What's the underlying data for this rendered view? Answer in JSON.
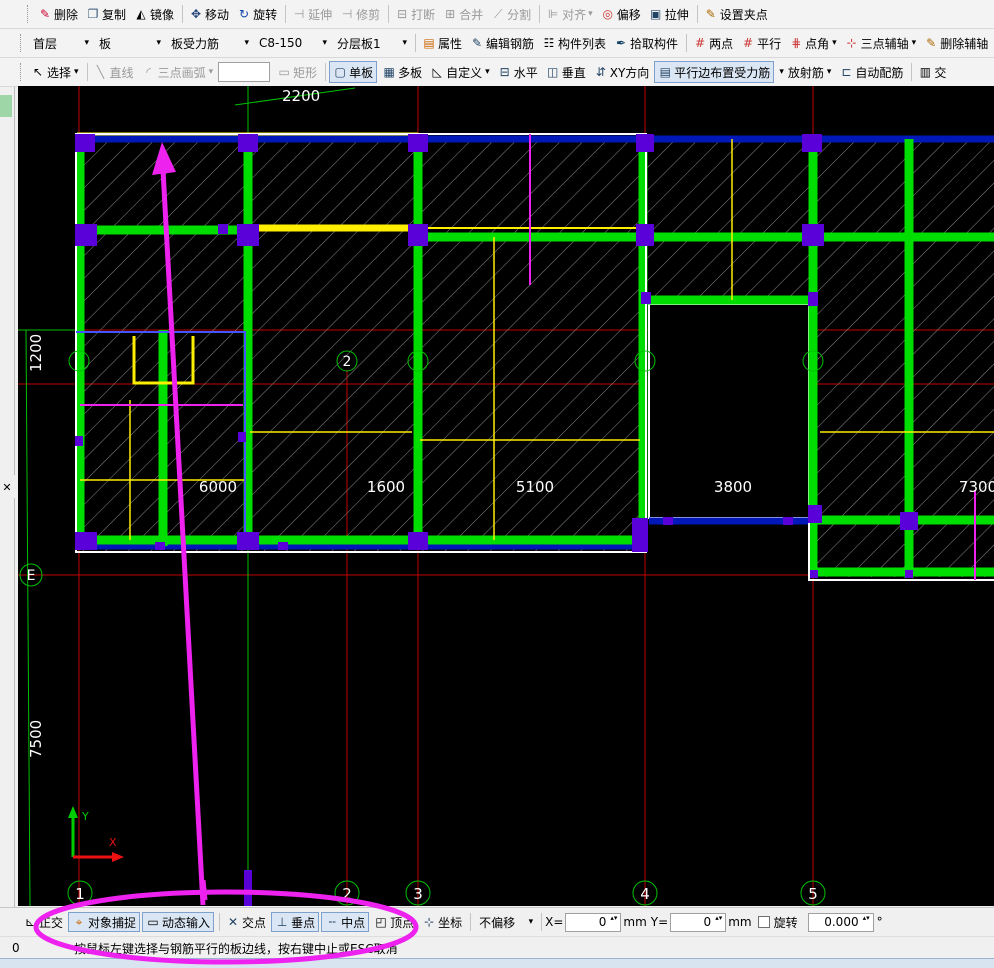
{
  "toolbar1": {
    "delete": "删除",
    "copy": "复制",
    "mirror": "镜像",
    "move": "移动",
    "rotate": "旋转",
    "extend": "延伸",
    "trim": "修剪",
    "break": "打断",
    "merge": "合并",
    "split": "分割",
    "align": "对齐",
    "offset": "偏移",
    "stretch": "拉伸",
    "set_grip": "设置夹点"
  },
  "toolbar2": {
    "floor": "首层",
    "component_type": "板",
    "rebar_type": "板受力筋",
    "rebar_spec": "C8-150",
    "layer": "分层板1",
    "properties": "属性",
    "edit_rebar": "编辑钢筋",
    "component_list": "构件列表",
    "pick_component": "拾取构件",
    "two_points": "两点",
    "parallel": "平行",
    "point_angle": "点角",
    "three_point_axis": "三点辅轴",
    "delete_axis": "删除辅轴"
  },
  "toolbar3": {
    "select": "选择",
    "line": "直线",
    "arc": "三点画弧",
    "rect": "矩形",
    "single_slab": "单板",
    "multi_slab": "多板",
    "custom": "自定义",
    "horizontal": "水平",
    "vertical": "垂直",
    "xy_dir": "XY方向",
    "parallel_edge": "平行边布置受力筋",
    "radial": "放射筋",
    "auto_rebar": "自动配筋",
    "cross": "交"
  },
  "drawing": {
    "top_dim": "2200",
    "left_dims": [
      "1200",
      "7500"
    ],
    "span_labels": [
      "6000",
      "1600",
      "5100",
      "3800",
      "7300"
    ],
    "axis_labels_bottom": [
      "1",
      "2",
      "3",
      "4",
      "5"
    ],
    "axis_labels_mid": [
      "1",
      "2",
      "3",
      "4",
      "5"
    ],
    "row_label": "E",
    "ucs_x": "X",
    "ucs_y": "Y"
  },
  "snap": {
    "ortho": "正交",
    "object_snap": "对象捕捉",
    "dynamic_input": "动态输入",
    "intersection": "交点",
    "perpendicular": "垂点",
    "midpoint": "中点",
    "endpoint": "顶点",
    "coordinate": "坐标",
    "offset_mode": "不偏移",
    "x_label": "X=",
    "x_value": "0",
    "y_label": "Y=",
    "y_value": "0",
    "unit": "mm",
    "rotate": "旋转",
    "angle": "0.000",
    "degree": "°"
  },
  "status": {
    "left_number": "0",
    "message": "按鼠标左键选择与钢筋平行的板边线，按右键中止或ESC取消"
  },
  "colors": {
    "canvas": "#000000",
    "beam_green": "#00dd00",
    "column": "#5a00d8",
    "beam_blue": "#0018b8",
    "yellow": "#ffee00",
    "grid_red": "#c00000",
    "annotation": "#ee22ee"
  }
}
